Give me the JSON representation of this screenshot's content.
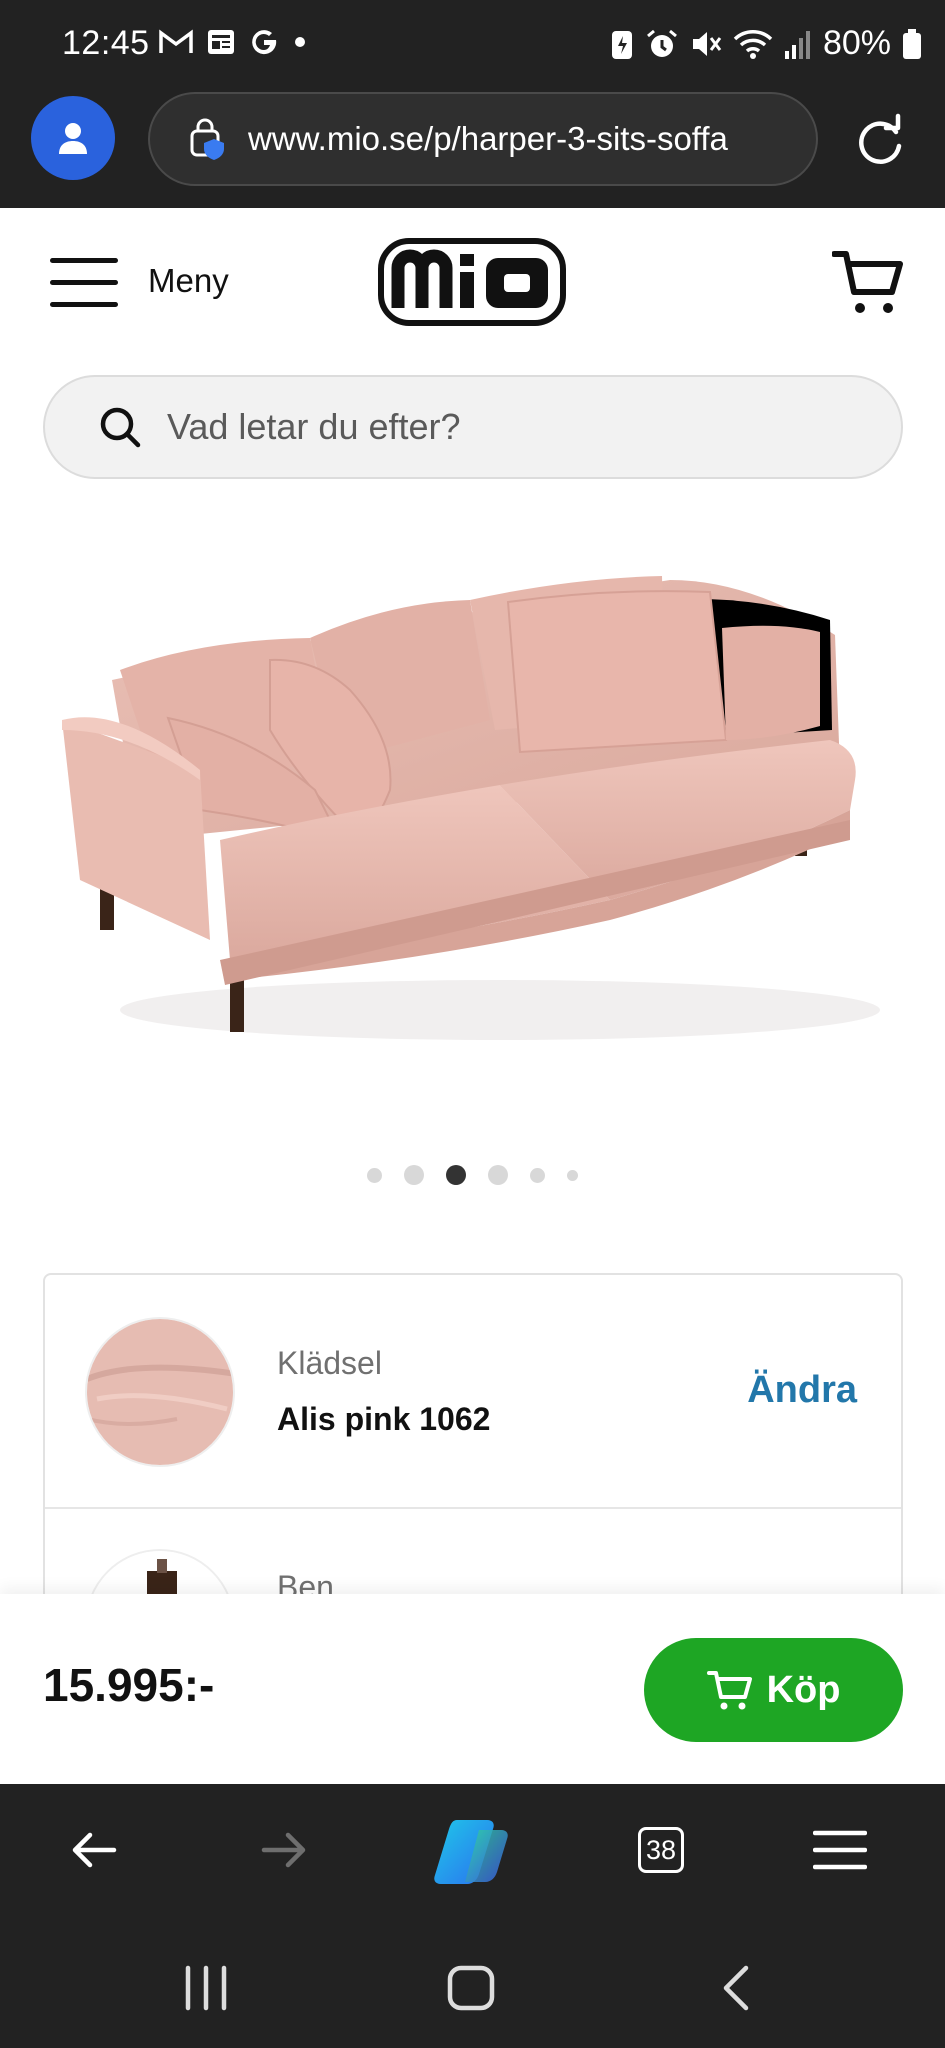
{
  "status_bar": {
    "time": "12:45",
    "battery": "80%",
    "left_icons": [
      "gmail-icon",
      "news-icon",
      "google-icon",
      "dot-icon"
    ],
    "right_icons": [
      "battery-saver-icon",
      "alarm-icon",
      "mute-icon",
      "wifi-icon",
      "signal-icon",
      "battery-icon"
    ]
  },
  "browser": {
    "url": "www.mio.se/p/harper-3-sits-soffa",
    "tab_count": "38"
  },
  "site_header": {
    "menu_label": "Meny",
    "logo_text": "MIO"
  },
  "search": {
    "placeholder": "Vad letar du efter?"
  },
  "gallery": {
    "slide_count": 6,
    "active_index": 2
  },
  "options": [
    {
      "label": "Klädsel",
      "value": "Alis pink 1062",
      "action": "Ändra"
    },
    {
      "label": "Ben",
      "value": "",
      "action": ""
    }
  ],
  "purchase": {
    "price": "15.995:-",
    "buy_label": "Köp"
  },
  "colors": {
    "buy_green": "#1ea624",
    "link_blue": "#2277aa",
    "profile_blue": "#2a62dd",
    "sofa_pink": "#e8b8ae"
  }
}
